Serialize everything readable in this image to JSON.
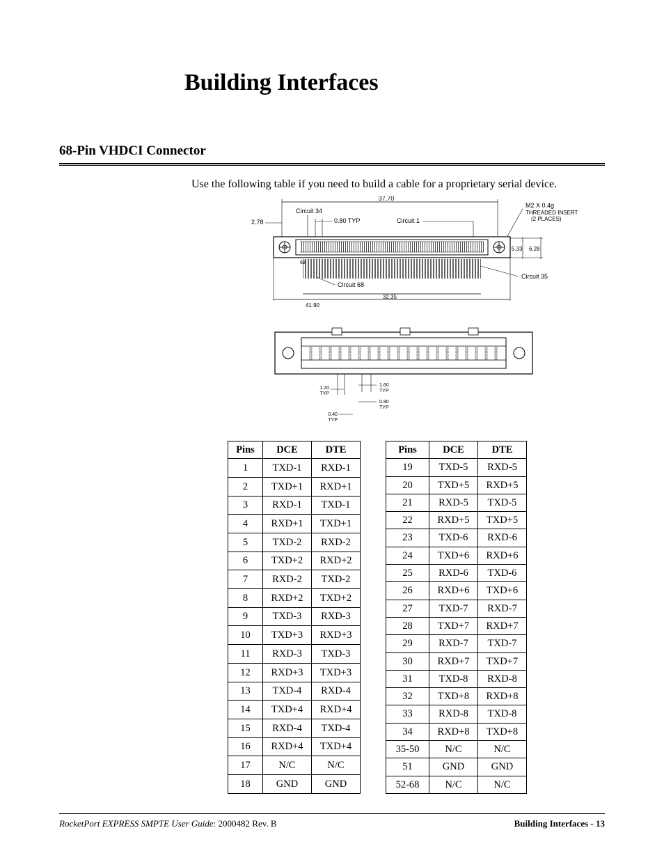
{
  "chapter_title": "Building Interfaces",
  "section_title": "68-Pin VHDCI Connector",
  "intro": "Use the following table if you need to build a cable for a proprietary serial device.",
  "diagram": {
    "top_width": "37.70",
    "left_dim": "2.78",
    "label_c34": "Circuit 34",
    "pitch": "0.80 TYP",
    "label_c1": "Circuit 1",
    "thread": "M2 X 0.4g",
    "thread2": "THREADED INSERT",
    "thread3": "(2 PLACES)",
    "right_dim1": "5.33",
    "right_dim2": "6.28",
    "label_c35": "Circuit 35",
    "label_c68": "Circuit 68",
    "bot_dim1": "41.90",
    "bot_dim2": "32.35",
    "lower_120": "1.20",
    "lower_typ": "TYP",
    "lower_160": "1.60",
    "lower_080": "0.80",
    "lower_040": "0.40"
  },
  "headers": {
    "pins": "Pins",
    "dce": "DCE",
    "dte": "DTE"
  },
  "left_table": [
    {
      "p": "1",
      "dce": "TXD-1",
      "dte": "RXD-1"
    },
    {
      "p": "2",
      "dce": "TXD+1",
      "dte": "RXD+1"
    },
    {
      "p": "3",
      "dce": "RXD-1",
      "dte": "TXD-1"
    },
    {
      "p": "4",
      "dce": "RXD+1",
      "dte": "TXD+1"
    },
    {
      "p": "5",
      "dce": "TXD-2",
      "dte": "RXD-2"
    },
    {
      "p": "6",
      "dce": "TXD+2",
      "dte": "RXD+2"
    },
    {
      "p": "7",
      "dce": "RXD-2",
      "dte": "TXD-2"
    },
    {
      "p": "8",
      "dce": "RXD+2",
      "dte": "TXD+2"
    },
    {
      "p": "9",
      "dce": "TXD-3",
      "dte": "RXD-3"
    },
    {
      "p": "10",
      "dce": "TXD+3",
      "dte": "RXD+3"
    },
    {
      "p": "11",
      "dce": "RXD-3",
      "dte": "TXD-3"
    },
    {
      "p": "12",
      "dce": "RXD+3",
      "dte": "TXD+3"
    },
    {
      "p": "13",
      "dce": "TXD-4",
      "dte": "RXD-4"
    },
    {
      "p": "14",
      "dce": "TXD+4",
      "dte": "RXD+4"
    },
    {
      "p": "15",
      "dce": "RXD-4",
      "dte": "TXD-4"
    },
    {
      "p": "16",
      "dce": "RXD+4",
      "dte": "TXD+4"
    },
    {
      "p": "17",
      "dce": "N/C",
      "dte": "N/C"
    },
    {
      "p": "18",
      "dce": "GND",
      "dte": "GND"
    }
  ],
  "right_table": [
    {
      "p": "19",
      "dce": "TXD-5",
      "dte": "RXD-5"
    },
    {
      "p": "20",
      "dce": "TXD+5",
      "dte": "RXD+5"
    },
    {
      "p": "21",
      "dce": "RXD-5",
      "dte": "TXD-5"
    },
    {
      "p": "22",
      "dce": "RXD+5",
      "dte": "TXD+5"
    },
    {
      "p": "23",
      "dce": "TXD-6",
      "dte": "RXD-6"
    },
    {
      "p": "24",
      "dce": "TXD+6",
      "dte": "RXD+6"
    },
    {
      "p": "25",
      "dce": "RXD-6",
      "dte": "TXD-6"
    },
    {
      "p": "26",
      "dce": "RXD+6",
      "dte": "TXD+6"
    },
    {
      "p": "27",
      "dce": "TXD-7",
      "dte": "RXD-7"
    },
    {
      "p": "28",
      "dce": "TXD+7",
      "dte": "RXD+7"
    },
    {
      "p": "29",
      "dce": "RXD-7",
      "dte": "TXD-7"
    },
    {
      "p": "30",
      "dce": "RXD+7",
      "dte": "TXD+7"
    },
    {
      "p": "31",
      "dce": "TXD-8",
      "dte": "RXD-8"
    },
    {
      "p": "32",
      "dce": "TXD+8",
      "dte": "RXD+8"
    },
    {
      "p": "33",
      "dce": "RXD-8",
      "dte": "TXD-8"
    },
    {
      "p": "34",
      "dce": "RXD+8",
      "dte": "TXD+8"
    },
    {
      "p": "35-50",
      "dce": "N/C",
      "dte": "N/C"
    },
    {
      "p": "51",
      "dce": "GND",
      "dte": "GND"
    },
    {
      "p": "52-68",
      "dce": "N/C",
      "dte": "N/C"
    }
  ],
  "footer": {
    "doc_title": "RocketPort EXPRESS SMPTE User Guide",
    "doc_rev": ": 2000482 Rev. B",
    "page_section": "Building Interfaces - 13"
  }
}
